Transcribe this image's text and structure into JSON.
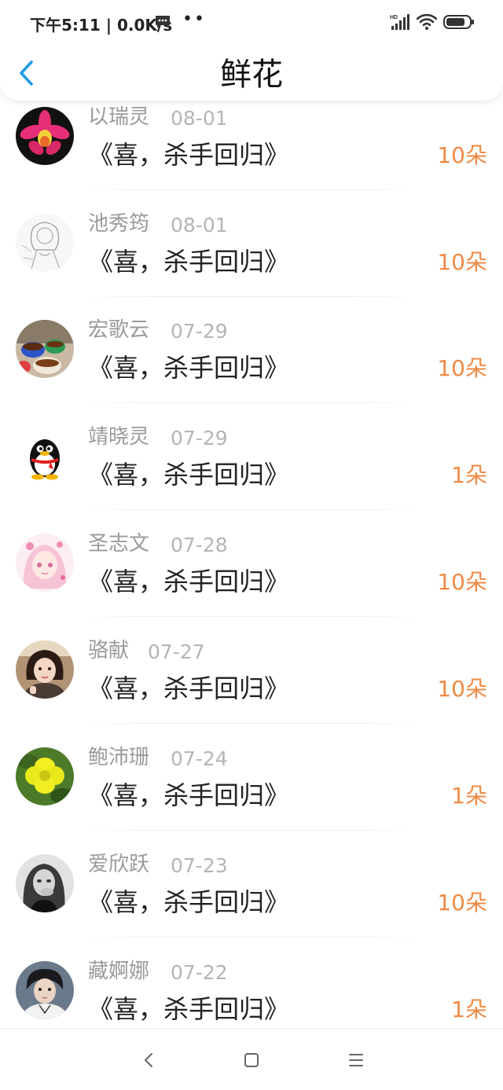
{
  "status_bar": {
    "time_speed": "下午5:11 | 0.0K/s",
    "dots": "••",
    "signal_label": "HD"
  },
  "header": {
    "title": "鲜花"
  },
  "records": [
    {
      "name": "以瑞灵",
      "date": "08-01",
      "gift": "《喜，杀手回归》",
      "count": "10朵",
      "avatar": "orchid-flower-avatar"
    },
    {
      "name": "池秀筠",
      "date": "08-01",
      "gift": "《喜，杀手回归》",
      "count": "10朵",
      "avatar": "sketch-girl-avatar"
    },
    {
      "name": "宏歌云",
      "date": "07-29",
      "gift": "《喜，杀手回归》",
      "count": "10朵",
      "avatar": "tea-cups-avatar"
    },
    {
      "name": "靖晓灵",
      "date": "07-29",
      "gift": "《喜，杀手回归》",
      "count": "1朵",
      "avatar": "qq-penguin-avatar"
    },
    {
      "name": "圣志文",
      "date": "07-28",
      "gift": "《喜，杀手回归》",
      "count": "10朵",
      "avatar": "anime-girl-avatar"
    },
    {
      "name": "骆献",
      "date": "07-27",
      "gift": "《喜，杀手回归》",
      "count": "10朵",
      "avatar": "child-photo-avatar"
    },
    {
      "name": "鲍沛珊",
      "date": "07-24",
      "gift": "《喜，杀手回归》",
      "count": "1朵",
      "avatar": "yellow-flower-avatar"
    },
    {
      "name": "爱欣跃",
      "date": "07-23",
      "gift": "《喜，杀手回归》",
      "count": "10朵",
      "avatar": "grayscale-girl-avatar"
    },
    {
      "name": "藏婀娜",
      "date": "07-22",
      "gift": "《喜，杀手回归》",
      "count": "1朵",
      "avatar": "young-man-avatar"
    }
  ],
  "colors": {
    "accent": "#1e9be6",
    "count": "#f08a44",
    "name": "#9a9a9a",
    "date": "#b5b5b5",
    "title": "#222222"
  }
}
